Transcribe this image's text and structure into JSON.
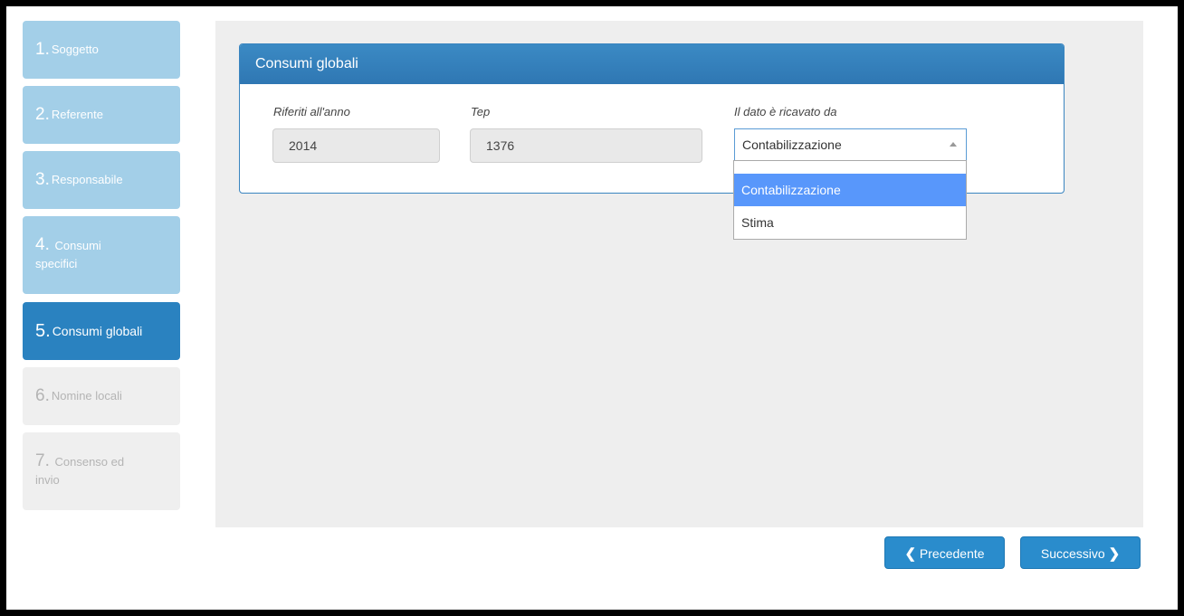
{
  "steps": [
    {
      "num": "1.",
      "label": "Soggetto",
      "state": "done"
    },
    {
      "num": "2.",
      "label": "Referente",
      "state": "done"
    },
    {
      "num": "3.",
      "label": "Responsabile",
      "state": "done"
    },
    {
      "num": "4.",
      "label": "Consumi specifici",
      "state": "done"
    },
    {
      "num": "5.",
      "label": "Consumi globali",
      "state": "active"
    },
    {
      "num": "6.",
      "label": "Nomine locali",
      "state": "future"
    },
    {
      "num": "7.",
      "label": "Consenso ed invio",
      "state": "future"
    }
  ],
  "panel": {
    "title": "Consumi globali",
    "year_label": "Riferiti all'anno",
    "year_value": "2014",
    "tep_label": "Tep",
    "tep_value": "1376",
    "source_label": "Il dato è ricavato da",
    "source_value": "Contabilizzazione",
    "source_options": [
      "Contabilizzazione",
      "Stima"
    ]
  },
  "nav": {
    "prev_label": "Precedente",
    "next_label": "Successivo"
  },
  "colors": {
    "accent": "#2a82c0",
    "step_done": "#a3cfe8",
    "option_highlight": "#5897fb"
  }
}
